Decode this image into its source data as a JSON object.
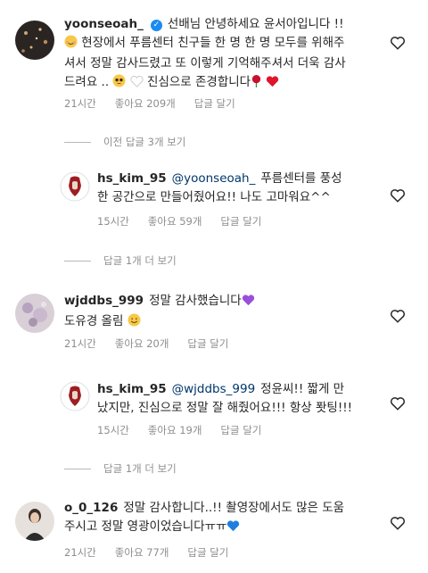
{
  "comments": [
    {
      "username": "yoonseoah_",
      "verified": true,
      "text_a": "선배님 안녕하세요 윤서아입니다 !!",
      "text_b": "현장에서 푸름센터 친구들 한 명 한 명 모두를 위해주",
      "text_c": "셔서 정말 감사드렸고 또 이렇게 기억해주셔서 더욱 감사",
      "text_d": "드려요 ..",
      "text_e": "진심으로 존경합니다",
      "time": "21시간",
      "likes": "좋아요 209개",
      "reply": "답글 달기"
    },
    {
      "view_prev": "이전 답글 3개 보기"
    },
    {
      "username": "hs_kim_95",
      "mention": "@yoonseoah_",
      "text_a": "푸름센터를 풍성",
      "text_b": "한 공간으로 만들어줬어요!! 나도 고마워요^^",
      "time": "15시간",
      "likes": "좋아요 59개",
      "reply": "답글 달기"
    },
    {
      "view_more": "답글 1개 더 보기"
    },
    {
      "username": "wjddbs_999",
      "text_a": "정말 감사했습니다",
      "text_b": "도유경 올림",
      "time": "21시간",
      "likes": "좋아요 20개",
      "reply": "답글 달기"
    },
    {
      "username": "hs_kim_95",
      "mention": "@wjddbs_999",
      "text_a": "정윤씨!! 짧게 만",
      "text_b": "났지만, 진심으로 정말 잘 해줬어요!!! 항상 퐛팅!!!",
      "time": "15시간",
      "likes": "좋아요 19개",
      "reply": "답글 달기"
    },
    {
      "view_more": "답글 1개 더 보기"
    },
    {
      "username": "o_0_126",
      "text_a": "정말 감사합니다..!! 촬영장에서도 많은 도움",
      "text_b": "주시고 정말 영광이었습니다ㅠㅠ",
      "time": "21시간",
      "likes": "좋아요 77개",
      "reply": "답글 달기"
    }
  ],
  "icons": {
    "heart": "heart-outline-icon",
    "verified": "verified-badge-icon"
  },
  "colors": {
    "mention": "#00376b",
    "meta": "#8e8e8e",
    "verified": "#1a8cf0"
  }
}
